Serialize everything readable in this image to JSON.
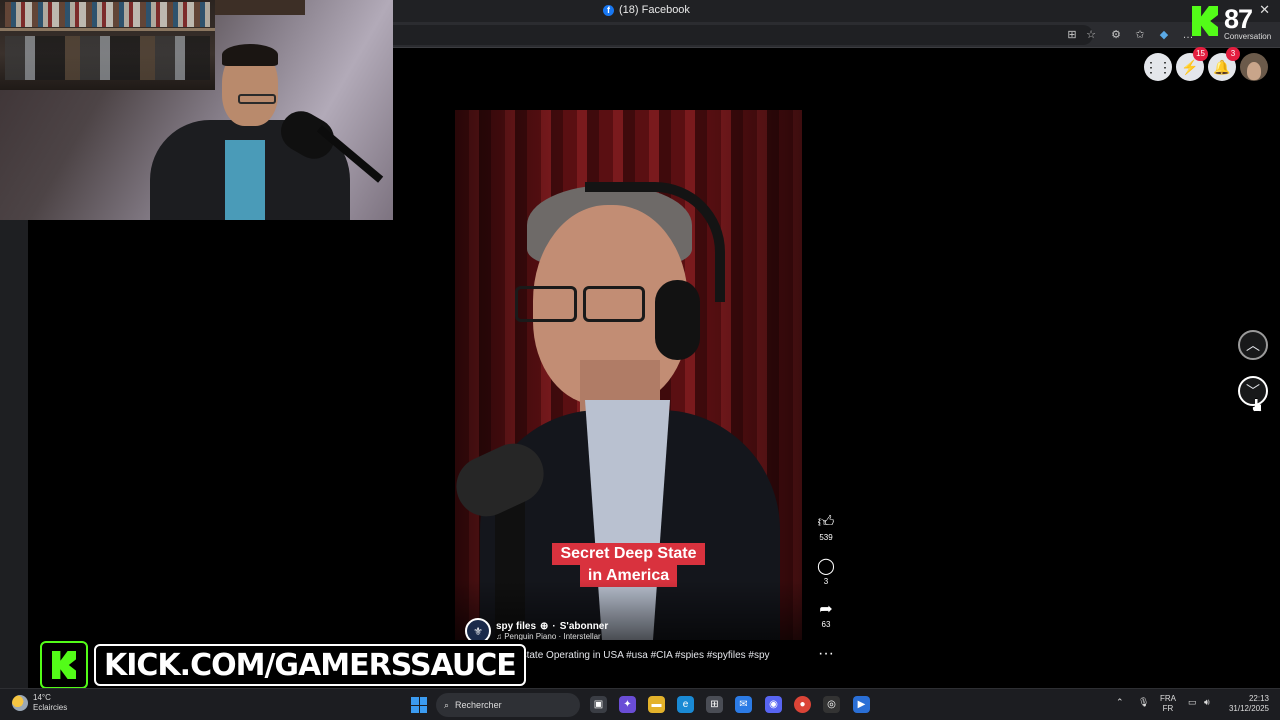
{
  "browser": {
    "tab_title": "(18) Facebook",
    "fb_glyph": "f"
  },
  "kick_overlay": {
    "viewer_count": "87",
    "label": "Conversation",
    "watermark_url": "KICK.COM/GAMERSSAUCE",
    "brand_color": "#53fc18"
  },
  "facebook_header": {
    "menu_icon": "grid-menu-icon",
    "messenger_badge": "15",
    "notifications_badge": "3"
  },
  "reel": {
    "caption_line1": "Secret Deep State",
    "caption_line2": "in America",
    "author_name": "spy files",
    "separator": "·",
    "follow_label": "S'abonner",
    "music": "♫ Penguin Piano · Interstellar",
    "description": "Secret Deepstate Operating in USA",
    "hashtags": [
      "#usa",
      "#CIA",
      "#spies",
      "#spyfiles",
      "#spy"
    ],
    "likes": "539",
    "comments": "3",
    "shares": "63",
    "caption_color": "#d9323e"
  },
  "taskbar": {
    "weather_temp": "14°C",
    "weather_desc": "Eclaircies",
    "search_placeholder": "Rechercher",
    "lang_top": "FRA",
    "lang_bottom": "FR",
    "time": "22:13",
    "date": "31/12/2025"
  }
}
